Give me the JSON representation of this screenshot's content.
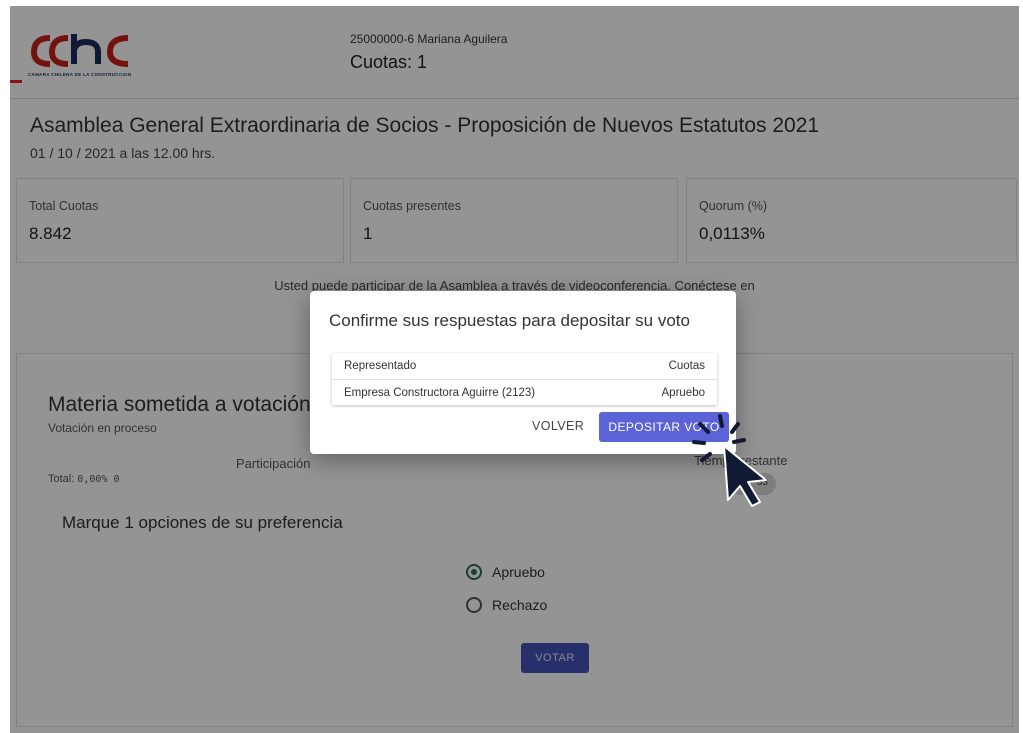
{
  "header": {
    "logo_text": "cchc",
    "logo_tagline": "CAMARA CHILENA DE LA CONSTRUCCION",
    "user": "25000000-6 Mariana Aguilera",
    "cuotas": "Cuotas: 1"
  },
  "assembly": {
    "title": "Asamblea General Extraordinaria de Socios - Proposición de Nuevos Estatutos 2021",
    "date": "01 / 10 / 2021 a las 12.00 hrs."
  },
  "stats": [
    {
      "label": "Total Cuotas",
      "value": "8.842"
    },
    {
      "label": "Cuotas presentes",
      "value": "1"
    },
    {
      "label": "Quorum (%)",
      "value": "0,0113%"
    }
  ],
  "notice": "Usted puede participar de la Asamblea a través de videoconferencia. Conéctese en",
  "vote": {
    "heading": "Materia sometida a votación",
    "status": "Votación en proceso",
    "participation_label": "Participación",
    "total_label": "Total:",
    "total_value": "0,00% 0",
    "time_label": "Tiempo restante",
    "time_value": "33",
    "instruction": "Marque 1 opciones de su preferencia",
    "options": [
      {
        "label": "Apruebo",
        "selected": true
      },
      {
        "label": "Rechazo",
        "selected": false
      }
    ],
    "submit_label": "VOTAR"
  },
  "dialog": {
    "title": "Confirme sus respuestas para depositar su voto",
    "columns": [
      "Representado",
      "Cuotas"
    ],
    "rows": [
      {
        "representado": "Empresa Constructora Aguirre (2123)",
        "cuotas": "Apruebo"
      }
    ],
    "cancel_label": "VOLVER",
    "confirm_label": "DEPOSITAR VOTO"
  },
  "colors": {
    "brand_red": "#c8201b",
    "brand_navy": "#1b2f5e",
    "primary_button": "#5b63d6",
    "radio_selected": "#2d6f58"
  }
}
